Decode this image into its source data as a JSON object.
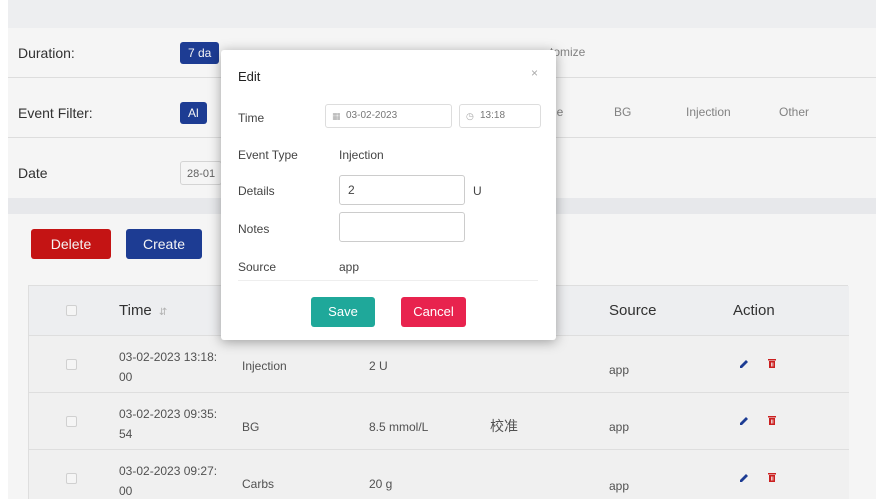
{
  "filters": {
    "duration_label": "Duration:",
    "duration_selected": "7 da",
    "duration_customize": "tomize",
    "event_filter_label": "Event Filter:",
    "event_filter_selected": "Al",
    "event_filter_options": [
      "ne",
      "BG",
      "Injection",
      "Other"
    ],
    "date_label": "Date",
    "date_value": "28-01"
  },
  "actions": {
    "delete_label": "Delete",
    "create_label": "Create"
  },
  "table": {
    "headers": {
      "time": "Time",
      "source": "Source",
      "action": "Action"
    },
    "sort_icon": "sort-icon",
    "rows": [
      {
        "time": "03-02-2023 13:18:",
        "time2": "00",
        "type": "Injection",
        "details": "2 U",
        "notes": "",
        "source": "app"
      },
      {
        "time": "03-02-2023 09:35:",
        "time2": "54",
        "type": "BG",
        "details": "8.5 mmol/L",
        "notes": "校准",
        "source": "app"
      },
      {
        "time": "03-02-2023 09:27:",
        "time2": "00",
        "type": "Carbs",
        "details": "20 g",
        "notes": "",
        "source": "app"
      }
    ]
  },
  "modal": {
    "title": "Edit",
    "close_icon": "×",
    "time_label": "Time",
    "date_value": "03-02-2023",
    "time_value": "13:18",
    "event_type_label": "Event Type",
    "event_type_value": "Injection",
    "details_label": "Details",
    "details_value": "2",
    "details_unit": "U",
    "notes_label": "Notes",
    "notes_value": "",
    "source_label": "Source",
    "source_value": "app",
    "save_label": "Save",
    "cancel_label": "Cancel"
  },
  "colors": {
    "primary": "#1f3f99",
    "danger": "#cc1515",
    "save": "#1fa89a",
    "cancel": "#e8234e",
    "edit_icon": "#1f3f99",
    "delete_icon": "#d42222"
  }
}
